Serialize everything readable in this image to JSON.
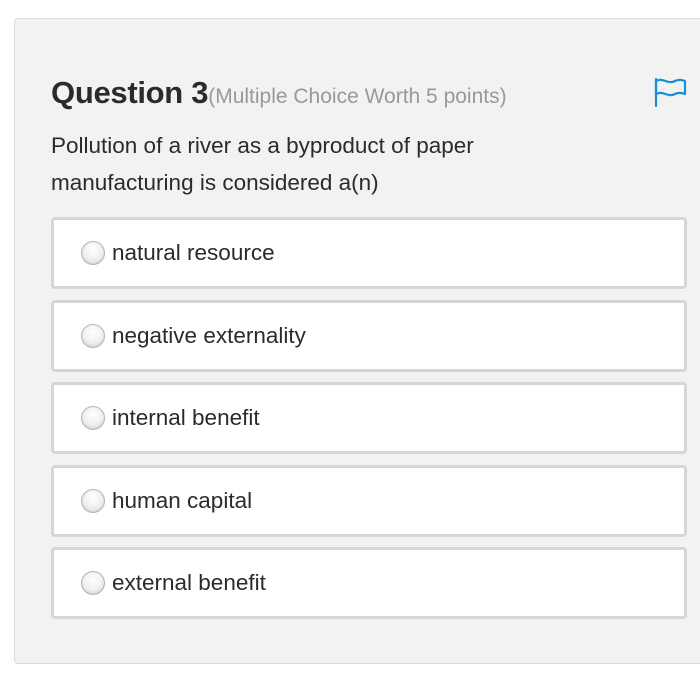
{
  "question": {
    "title": "Question 3",
    "meta": "(Multiple Choice Worth 5 points)",
    "prompt": "Pollution of a river as a byproduct of paper manufacturing is considered a(n)",
    "flag_icon": "flag-icon",
    "accent_color": "#1a8fd6"
  },
  "options": [
    {
      "label": "natural resource",
      "selected": false
    },
    {
      "label": "negative externality",
      "selected": false
    },
    {
      "label": "internal benefit",
      "selected": false
    },
    {
      "label": "human capital",
      "selected": false
    },
    {
      "label": "external benefit",
      "selected": false
    }
  ]
}
